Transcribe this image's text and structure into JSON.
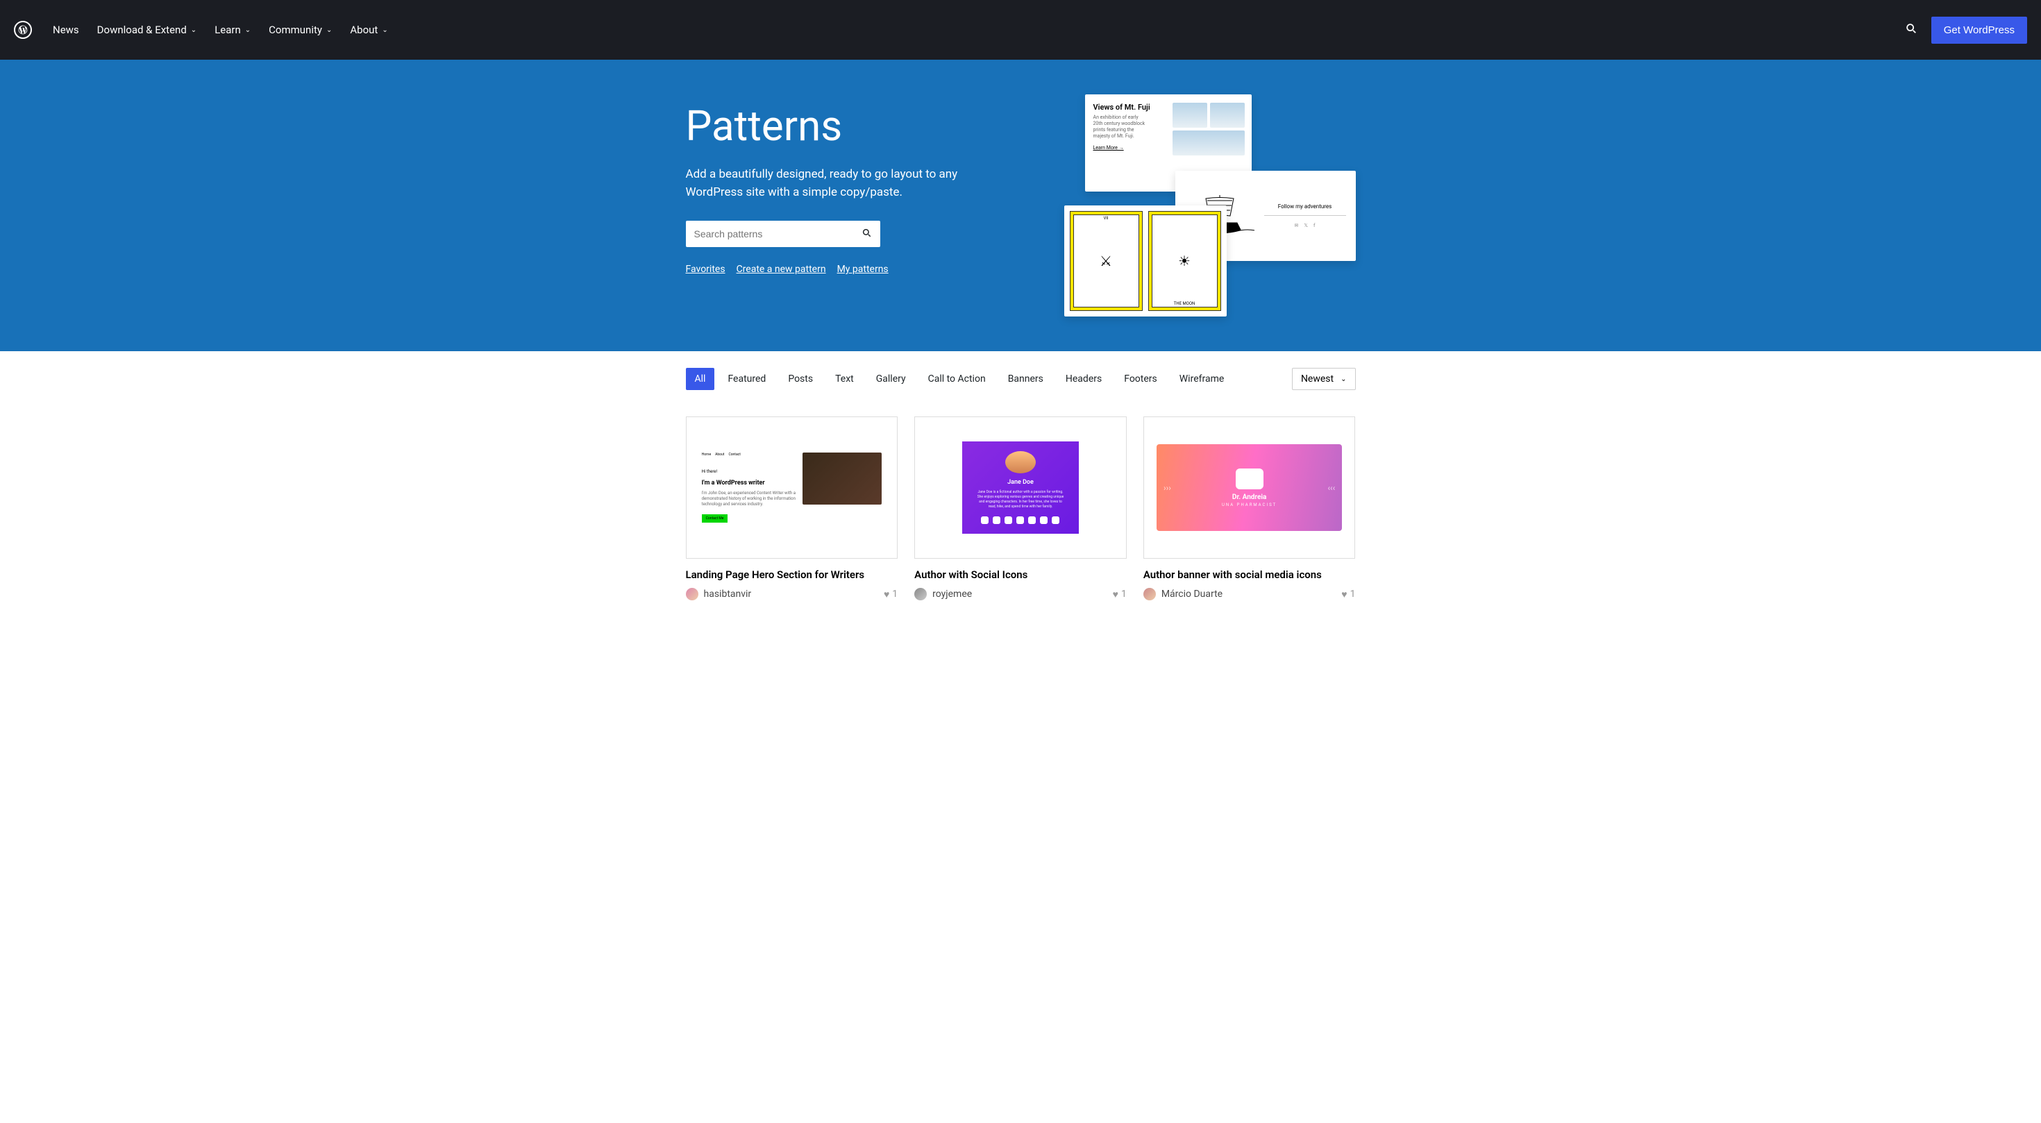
{
  "nav": {
    "news": "News",
    "download": "Download & Extend",
    "learn": "Learn",
    "community": "Community",
    "about": "About",
    "get_wp": "Get WordPress"
  },
  "hero": {
    "title": "Patterns",
    "desc": "Add a beautifully designed, ready to go layout to any WordPress site with a simple copy/paste.",
    "search_placeholder": "Search patterns",
    "link_favorites": "Favorites",
    "link_create": "Create a new pattern",
    "link_my": "My patterns",
    "card_a_title": "Views of Mt. Fuji",
    "card_a_desc": "An exhibition of early 20th century woodblock prints featuring the majesty of Mt. Fuji.",
    "card_a_learn": "Learn More →",
    "card_b_text": "Follow my adventures",
    "tarot1": "VII",
    "tarot2_label": "THE MOON"
  },
  "filters": {
    "tabs": [
      "All",
      "Featured",
      "Posts",
      "Text",
      "Gallery",
      "Call to Action",
      "Banners",
      "Headers",
      "Footers",
      "Wireframe"
    ],
    "sort": "Newest"
  },
  "patterns": [
    {
      "title": "Landing Page Hero Section for Writers",
      "author": "hasibtanvir",
      "likes": "1",
      "preview": {
        "nav": [
          "Home",
          "About",
          "Contact"
        ],
        "hi": "Hi there!",
        "heading": "I'm a WordPress writer",
        "desc": "I'm John Doe, an experienced Content Writer with a demonstrated history of working in the information technology and services industry.",
        "btn": "Contact Me"
      }
    },
    {
      "title": "Author with Social Icons",
      "author": "royjemee",
      "likes": "1",
      "preview": {
        "name": "Jane Doe",
        "desc": "Jane Doe is a fictional author with a passion for writing. She enjoys exploring various genres and creating unique and engaging characters. In her free time, she loves to read, hike, and spend time with her family."
      }
    },
    {
      "title": "Author banner with social media icons",
      "author": "Márcio Duarte",
      "likes": "1",
      "preview": {
        "name": "Dr. Andreia",
        "role": "UNA PHARMACIST"
      }
    }
  ]
}
